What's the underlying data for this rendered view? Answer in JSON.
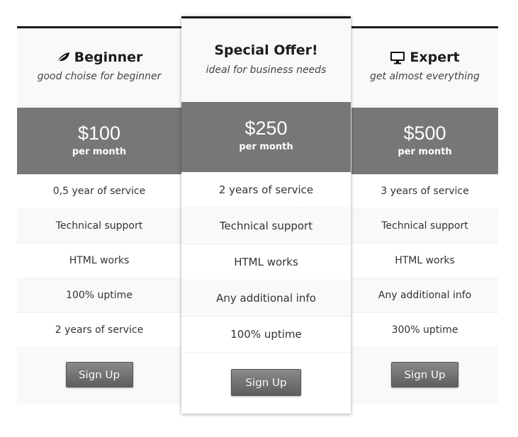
{
  "plans": [
    {
      "title": "Beginner",
      "icon": "leaf-icon",
      "subtitle": "good choise for beginner",
      "price": "$100",
      "period": "per month",
      "features": [
        "0,5 year of service",
        "Technical support",
        "HTML works",
        "100% uptime",
        "2 years of service"
      ],
      "button_label": "Sign Up"
    },
    {
      "title": "Special Offer!",
      "subtitle": "ideal for business needs",
      "price": "$250",
      "period": "per month",
      "features": [
        "2 years of service",
        "Technical support",
        "HTML works",
        "Any additional info",
        "100% uptime"
      ],
      "button_label": "Sign Up"
    },
    {
      "title": "Expert",
      "icon": "monitor-icon",
      "subtitle": "get almost everything",
      "price": "$500",
      "period": "per month",
      "features": [
        "3 years of service",
        "Technical support",
        "HTML works",
        "Any additional info",
        "300% uptime"
      ],
      "button_label": "Sign Up"
    }
  ],
  "colors": {
    "price_band": "#777777",
    "header_bg": "#f9f9f9",
    "top_border": "#1a1a1a",
    "button": "#6f6f6f"
  }
}
